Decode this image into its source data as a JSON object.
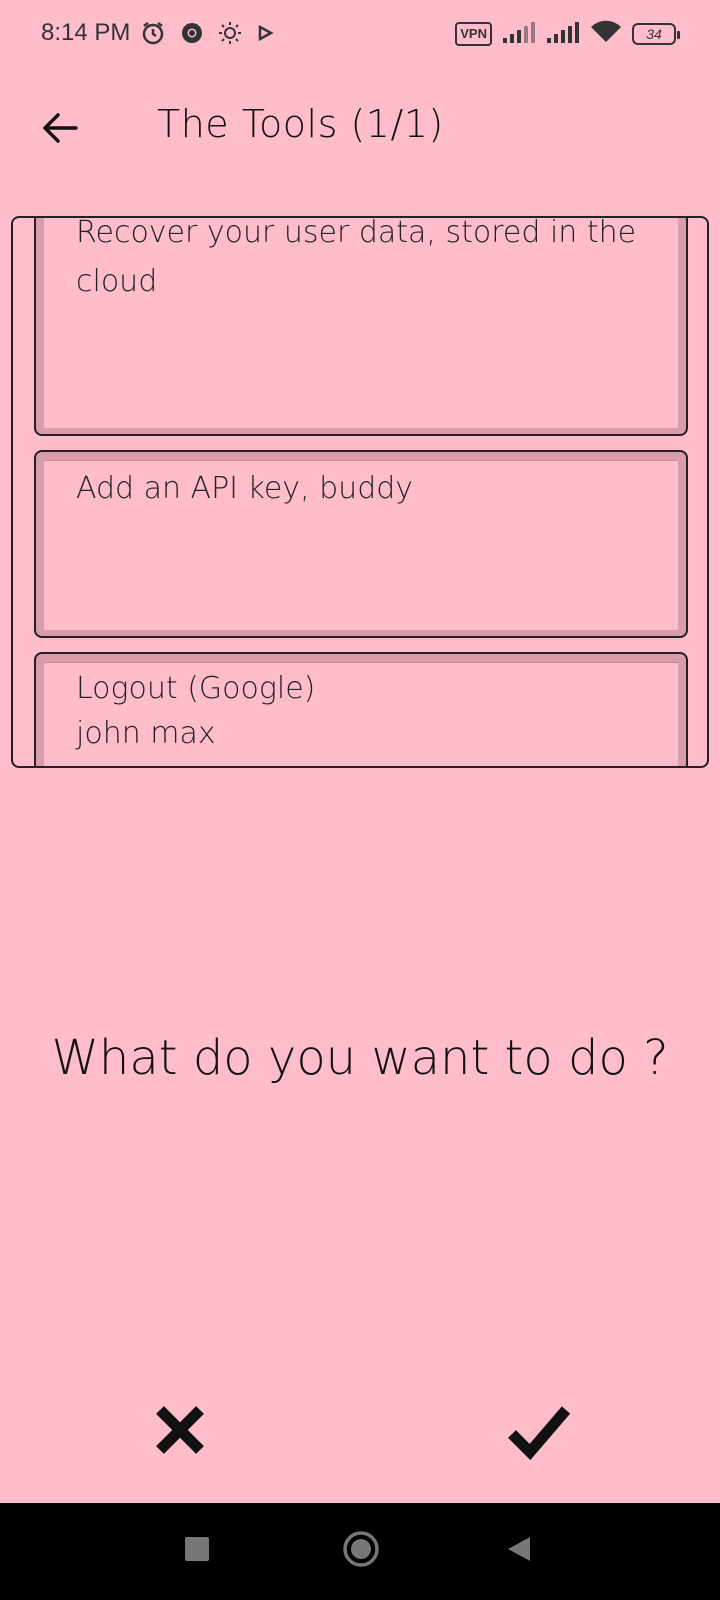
{
  "status_bar": {
    "time": "8:14 PM",
    "vpn_label": "VPN",
    "battery_level": "34",
    "icons": [
      "alarm-icon",
      "chrome-icon",
      "brightness-icon",
      "play-icon",
      "signal-icon",
      "signal-icon",
      "wifi-icon",
      "battery-icon"
    ]
  },
  "app_bar": {
    "back_icon": "arrow-left-icon",
    "title": "The Tools (1/1)"
  },
  "tools": [
    {
      "label": "Recover your user data, stored in the cloud"
    },
    {
      "label": "Add an API key, buddy"
    },
    {
      "label": "Logout (Google)\njohn max"
    }
  ],
  "prompt": "What do you want to do ?",
  "actions": {
    "cancel_icon": "close-icon",
    "confirm_icon": "check-icon"
  },
  "nav_bar": {
    "icons": [
      "recents-icon",
      "home-icon",
      "back-triangle-icon"
    ]
  },
  "colors": {
    "background": "#FFBDCB",
    "item_border": "#D99CA8",
    "text": "#111111"
  }
}
